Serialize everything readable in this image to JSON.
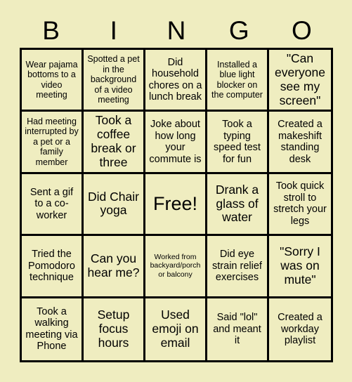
{
  "card": {
    "title": "BINGO Card",
    "background_color": "#efedc0",
    "line_color": "#000000",
    "text_color": "#000000"
  },
  "header": {
    "letters": [
      "B",
      "I",
      "N",
      "G",
      "O"
    ]
  },
  "grid": {
    "columns": 5,
    "rows": 5,
    "free_space_index": 12,
    "cells": [
      {
        "text": "Wear pajama bottoms to a video meeting",
        "size": "s"
      },
      {
        "text": "Spotted a pet in the background of a video meeting",
        "size": "s"
      },
      {
        "text": "Did household chores on a lunch break",
        "size": "m"
      },
      {
        "text": "Installed a blue light blocker on the computer",
        "size": "s"
      },
      {
        "text": "\"Can everyone see my screen\"",
        "size": "l"
      },
      {
        "text": "Had meeting interrupted by a pet or a family member",
        "size": "s"
      },
      {
        "text": "Took a coffee break or three",
        "size": "l"
      },
      {
        "text": "Joke about how long your commute is",
        "size": "m"
      },
      {
        "text": "Took a typing speed test for fun",
        "size": "m"
      },
      {
        "text": "Created a makeshift standing desk",
        "size": "m"
      },
      {
        "text": "Sent a gif to a co-worker",
        "size": "m"
      },
      {
        "text": "Did Chair yoga",
        "size": "l"
      },
      {
        "text": "Free!",
        "size": "xl"
      },
      {
        "text": "Drank a glass of water",
        "size": "l"
      },
      {
        "text": "Took quick stroll to stretch your legs",
        "size": "m"
      },
      {
        "text": "Tried the Pomodoro technique",
        "size": "m"
      },
      {
        "text": "Can you hear me?",
        "size": "l"
      },
      {
        "text": "Worked from backyard/porch or balcony",
        "size": "xs"
      },
      {
        "text": "Did eye strain relief exercises",
        "size": "m"
      },
      {
        "text": "\"Sorry I was on mute\"",
        "size": "l"
      },
      {
        "text": "Took a walking meeting via Phone",
        "size": "m"
      },
      {
        "text": "Setup focus hours",
        "size": "l"
      },
      {
        "text": "Used emoji on email",
        "size": "l"
      },
      {
        "text": "Said \"lol\" and meant it",
        "size": "m"
      },
      {
        "text": "Created a workday playlist",
        "size": "m"
      }
    ]
  }
}
